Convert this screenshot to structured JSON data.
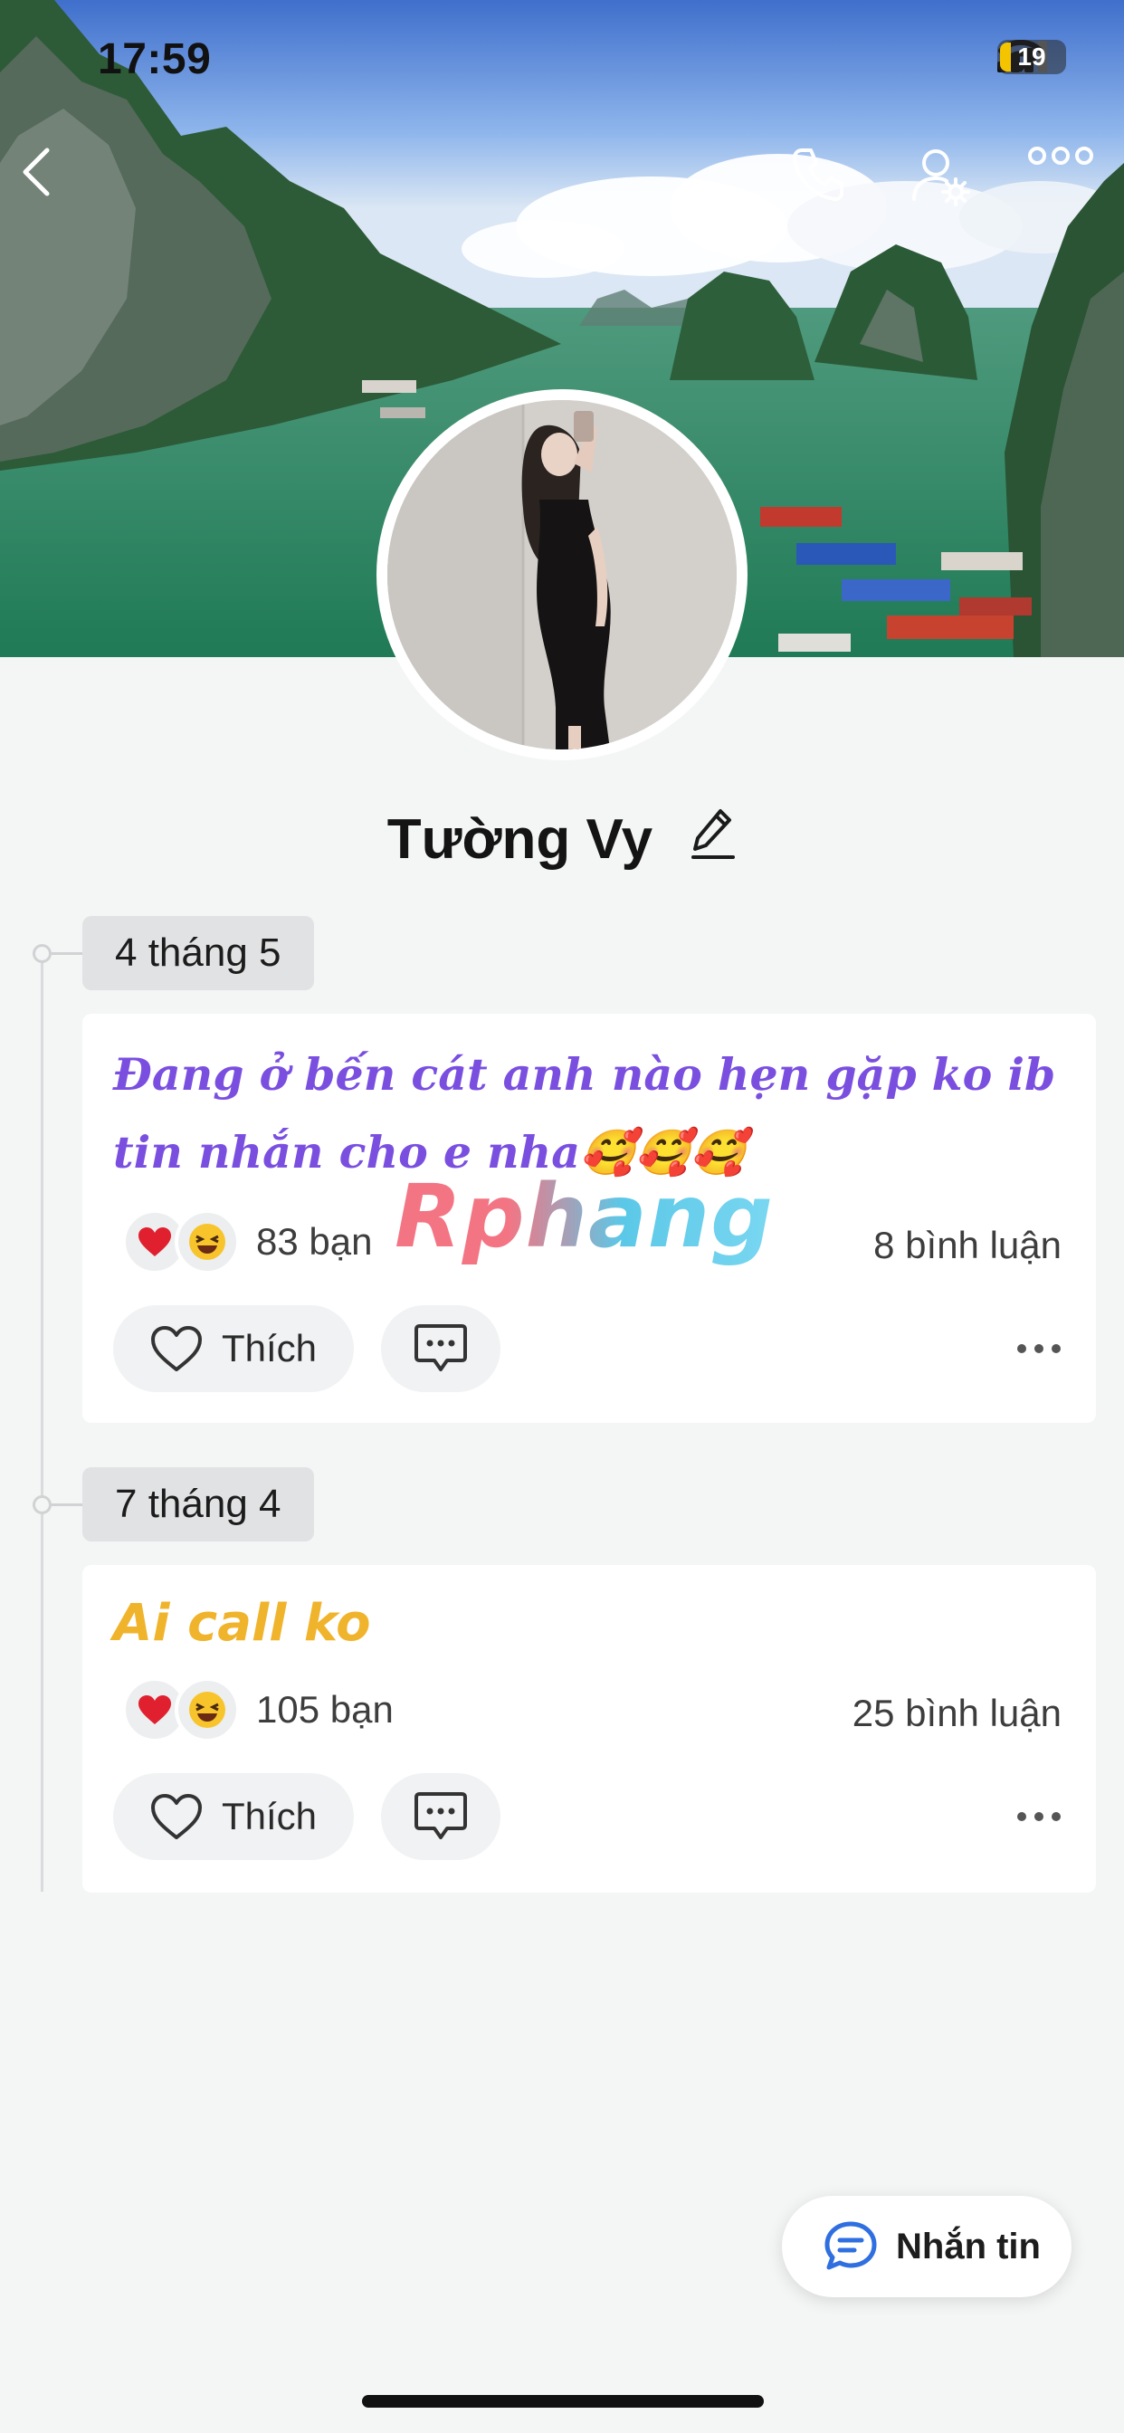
{
  "status_bar": {
    "time": "17:59",
    "battery": "19"
  },
  "nav": {
    "back_icon": "chevron-left-icon",
    "call_icon": "phone-icon",
    "settings_icon": "user-settings-icon",
    "more_icon": "more-horizontal-icon"
  },
  "profile": {
    "name": "Tường Vy",
    "edit_icon": "pencil-icon"
  },
  "posts": [
    {
      "date": "4 tháng 5",
      "text": "Đang ở bến cát anh nào hẹn gặp ko ib tin nhắn cho e nha🥰🥰🥰",
      "text_color": "#7a4fe0",
      "reactions": [
        "heart",
        "laughing"
      ],
      "reaction_count": "83 bạn",
      "comment_count": "8 bình luận",
      "like_label": "Thích"
    },
    {
      "date": "7 tháng 4",
      "text": "Ai call ko",
      "text_color": "#f0b42c",
      "reactions": [
        "heart",
        "laughing"
      ],
      "reaction_count": "105 bạn",
      "comment_count": "25 bình luận",
      "like_label": "Thích"
    }
  ],
  "watermark": "Rphang",
  "message_button": {
    "label": "Nhắn tin",
    "icon": "chat-bubble-icon"
  },
  "colors": {
    "accent_blue": "#2f6fe0",
    "background": "#f4f5f5"
  }
}
